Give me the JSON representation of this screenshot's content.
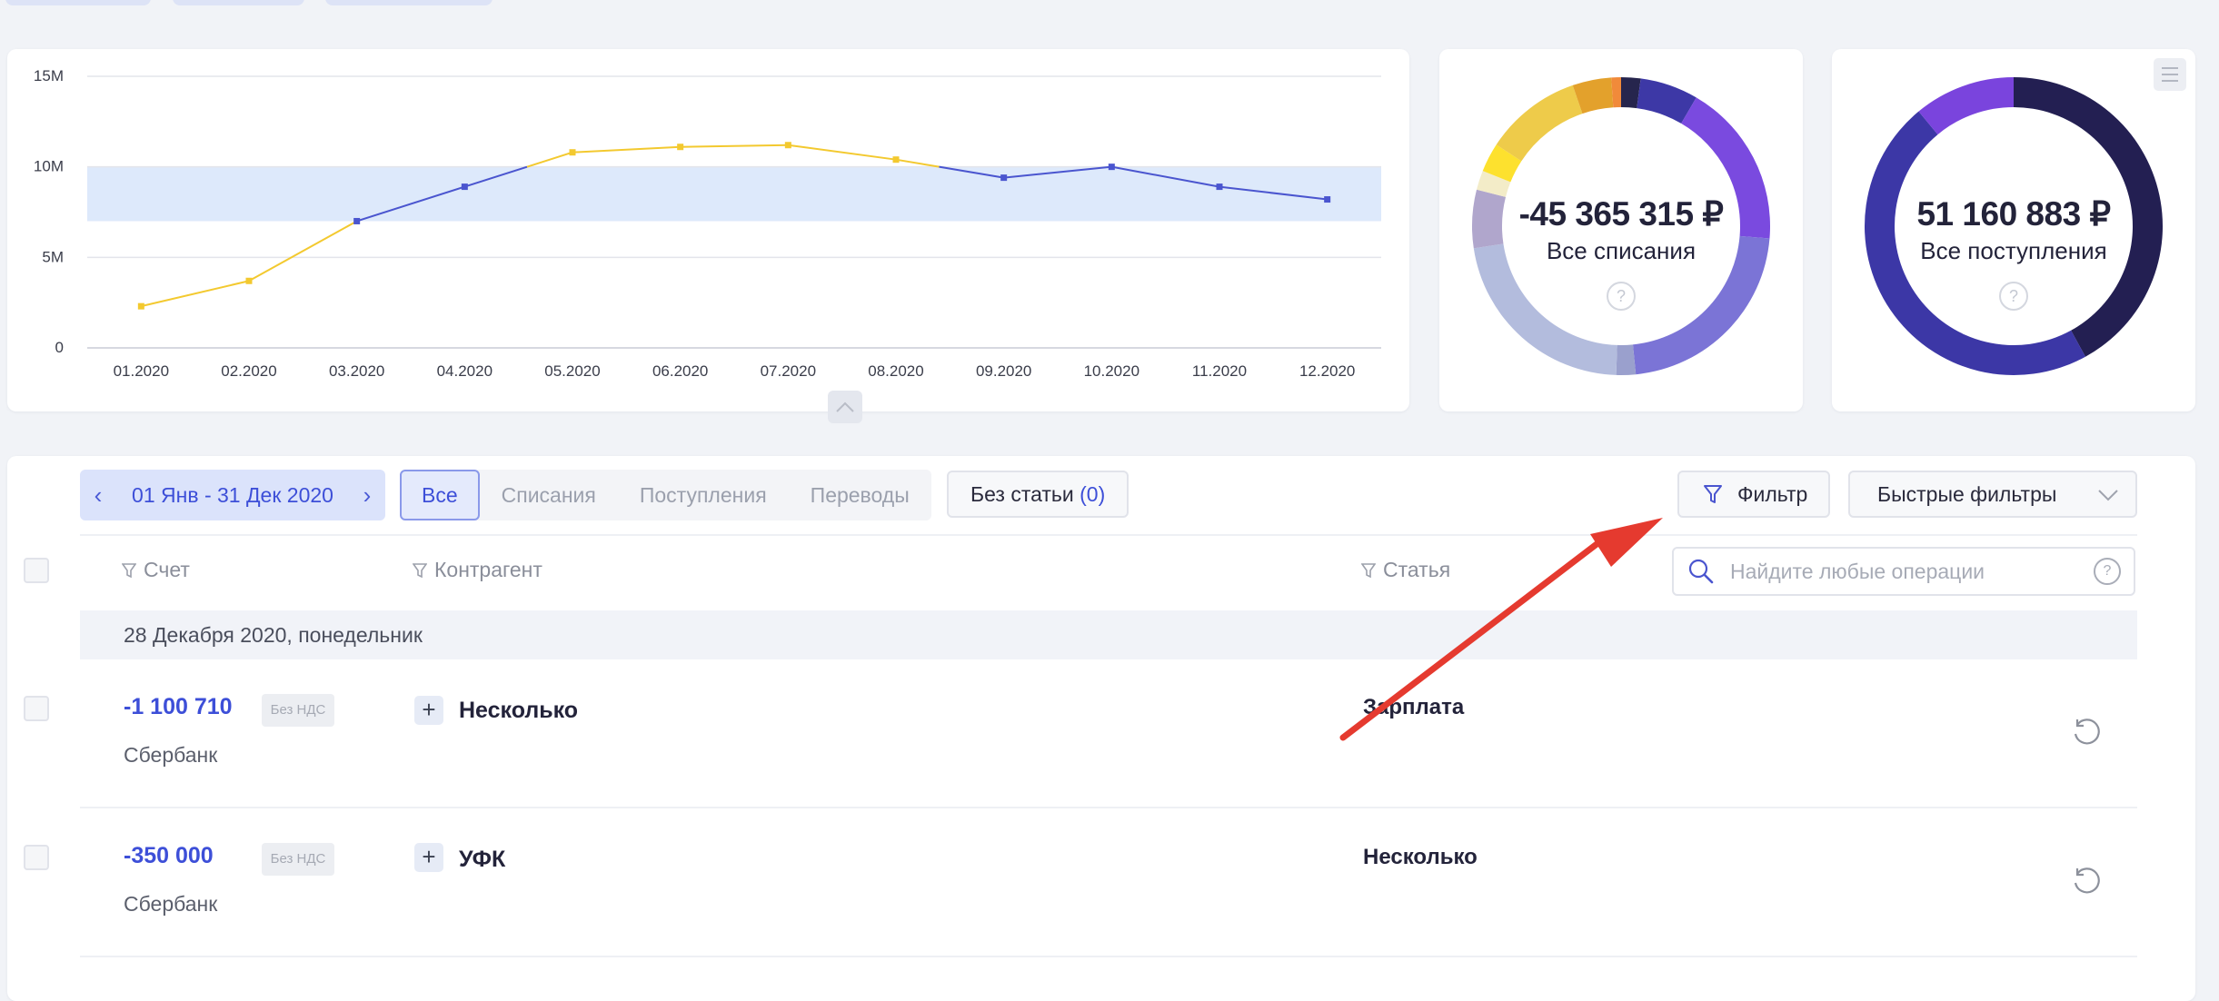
{
  "chart_data": [
    {
      "type": "line",
      "categories": [
        "01.2020",
        "02.2020",
        "03.2020",
        "04.2020",
        "05.2020",
        "06.2020",
        "07.2020",
        "08.2020",
        "09.2020",
        "10.2020",
        "11.2020",
        "12.2020"
      ],
      "values": [
        2.3,
        3.7,
        7.0,
        8.9,
        10.8,
        11.1,
        11.2,
        10.4,
        9.4,
        10.0,
        8.9,
        8.2
      ],
      "yticks": [
        "15M",
        "10M",
        "5M",
        "0"
      ],
      "ylim": [
        0,
        15
      ],
      "band": [
        7,
        10
      ],
      "colors": {
        "above_band": "#f3c92f",
        "inside_band": "#4a55cf",
        "band_fill": "#dde9fb"
      },
      "grid": true
    },
    {
      "type": "pie",
      "center_amount": "-45 365 315 ₽",
      "center_label": "Все списания",
      "slices": [
        {
          "value": 2.0,
          "color": "#26254d"
        },
        {
          "value": 6.0,
          "color": "#3d38a6"
        },
        {
          "value": 17.0,
          "color": "#7a4adf"
        },
        {
          "value": 21.0,
          "color": "#7b74d6"
        },
        {
          "value": 2.0,
          "color": "#9aa0cd"
        },
        {
          "value": 21.0,
          "color": "#b3bcdd"
        },
        {
          "value": 6.0,
          "color": "#b0a6cc"
        },
        {
          "value": 2.0,
          "color": "#f3ecc8"
        },
        {
          "value": 3.0,
          "color": "#fde12e"
        },
        {
          "value": 10.0,
          "color": "#eecb4a"
        },
        {
          "value": 4.0,
          "color": "#e3a12c"
        },
        {
          "value": 1.0,
          "color": "#f18a3a"
        }
      ]
    },
    {
      "type": "pie",
      "center_amount": "51 160 883 ₽",
      "center_label": "Все поступления",
      "slices": [
        {
          "value": 42.0,
          "color": "#231f52"
        },
        {
          "value": 47.0,
          "color": "#3c37a6"
        },
        {
          "value": 11.0,
          "color": "#7a44dd"
        }
      ]
    }
  ],
  "toolbar": {
    "date_range": "01 Янв - 31 Дек 2020",
    "tabs": [
      "Все",
      "Списания",
      "Поступления",
      "Переводы"
    ],
    "no_article_label": "Без статьи",
    "no_article_count": "(0)",
    "filter_label": "Фильтр",
    "quick_filters_label": "Быстрые фильтры"
  },
  "search": {
    "placeholder": "Найдите любые операции"
  },
  "columns": {
    "account": "Счет",
    "counterparty": "Контрагент",
    "article": "Статья"
  },
  "date_group": "28 Декабря 2020, понедельник",
  "rows": [
    {
      "amount": "-1 100 710",
      "vat": "Без НДС",
      "bank": "Сбербанк",
      "counterparty": "Несколько",
      "article": "Зарплата"
    },
    {
      "amount": "-350 000",
      "vat": "Без НДС",
      "bank": "Сбербанк",
      "counterparty": "УФК",
      "article": "Несколько"
    }
  ],
  "icons": {
    "collapse": "chevron-up-icon",
    "menu": "hamburger-menu-icon",
    "help": "question-icon",
    "search": "search-icon",
    "filter": "funnel-icon",
    "restore": "restore-icon",
    "add": "plus-icon",
    "arrow": "annotation-arrow"
  }
}
